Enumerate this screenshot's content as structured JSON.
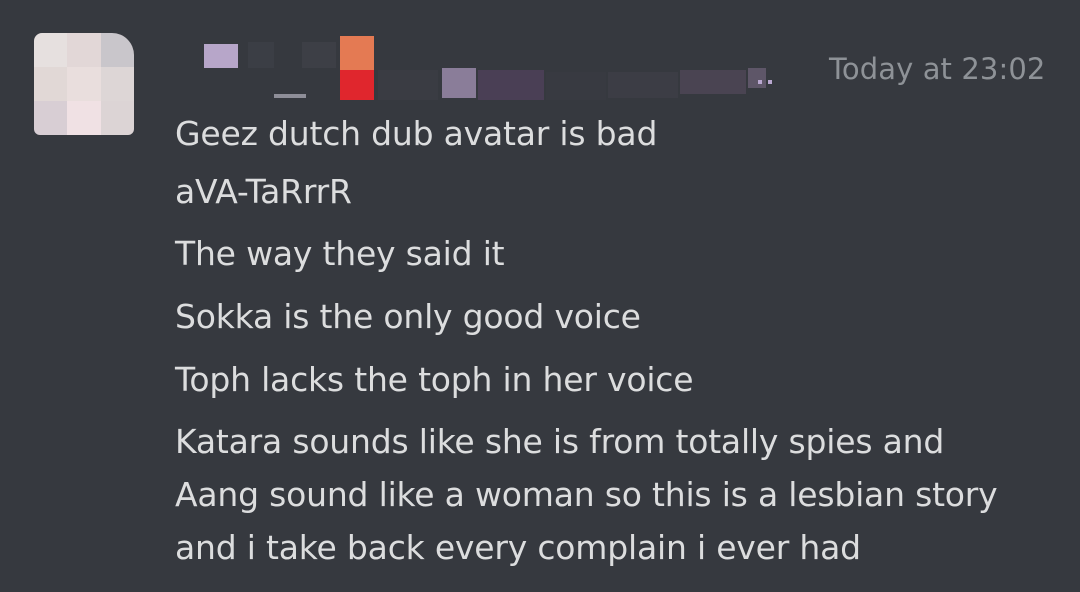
{
  "message": {
    "timestamp": "Today at 23:02",
    "lines": [
      "Geez dutch dub avatar is bad",
      "aVA-TaRrrR",
      "The way they said it",
      "Sokka is the only good voice",
      "Toph lacks the toph in her voice",
      "Katara sounds like she is from totally spies and",
      "Aang sound like a woman so this is a lesbian story",
      "and i take back every complain i ever had"
    ]
  },
  "colors": {
    "background": "#36393f",
    "message_text": "#dcddde",
    "timestamp_text": "#8e9297"
  },
  "icons": {
    "avatar": "pixelated-avatar-icon",
    "username": "redacted-username"
  }
}
